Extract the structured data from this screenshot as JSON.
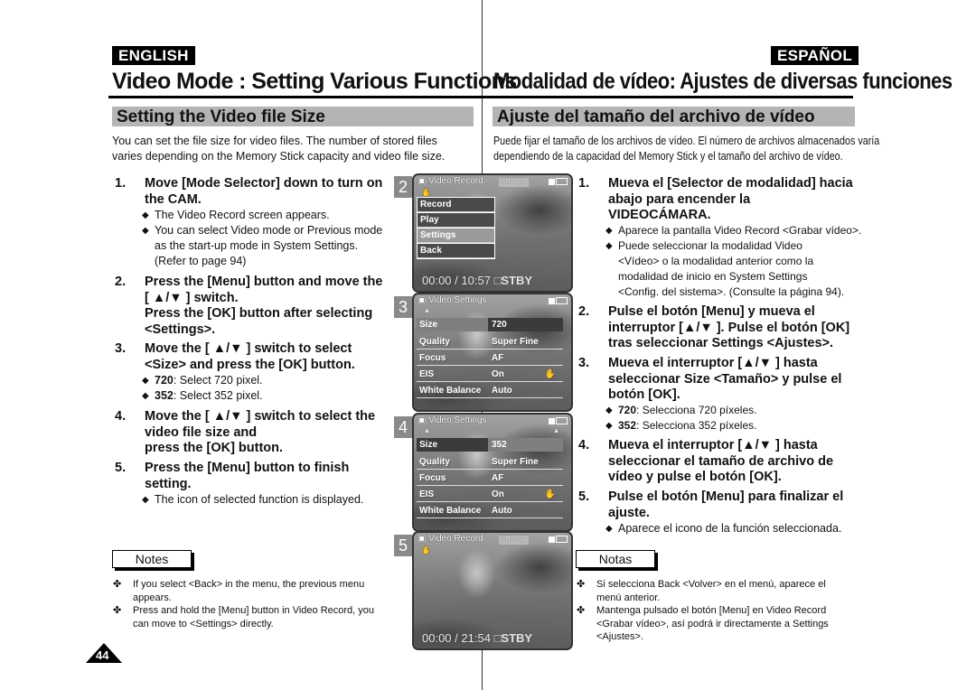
{
  "page_number": "44",
  "english": {
    "lang_label": "ENGLISH",
    "title": "Video Mode : Setting Various Functions",
    "section": "Setting the Video file Size",
    "intro": [
      "You can set the file size for video files. The number of stored files",
      "varies depending on the Memory Stick capacity and video file size."
    ],
    "steps": [
      {
        "num": "1.",
        "lines": [
          "Move [Mode Selector] down to turn on",
          "the CAM."
        ]
      },
      {
        "num": "2.",
        "lines": [
          "Press the [Menu] button and move the",
          "[ ▲/▼ ] switch.",
          "Press the [OK] button after selecting",
          "<Settings>."
        ]
      },
      {
        "num": "3.",
        "lines": [
          "Move the [ ▲/▼ ] switch to select",
          "<Size> and press the [OK] button."
        ]
      },
      {
        "num": "4.",
        "lines": [
          "Move the [ ▲/▼ ] switch to select the",
          "video file size and",
          "press the [OK] button."
        ]
      },
      {
        "num": "5.",
        "lines": [
          "Press the [Menu] button to finish",
          "setting."
        ]
      }
    ],
    "bullets": {
      "step1": [
        "The Video Record screen appears.",
        "You can select Video mode or Previous mode",
        "as the start-up mode in System Settings.",
        "(Refer to page 94)"
      ],
      "step3": [
        {
          "bold": "720",
          "text": ": Select 720 pixel."
        },
        {
          "bold": "352",
          "text": ": Select 352 pixel."
        }
      ],
      "step5": [
        "The icon of selected function is displayed."
      ]
    },
    "notes_label": "Notes",
    "notes": [
      [
        "If you select <Back> in the menu, the previous menu",
        "appears."
      ],
      [
        "Press and hold the [Menu] button in Video Record, you",
        "can move to <Settings> directly."
      ]
    ]
  },
  "spanish": {
    "lang_label": "ESPAÑOL",
    "title": "Modalidad de vídeo: Ajustes de diversas funciones",
    "section": "Ajuste del tamaño del archivo de vídeo",
    "intro": [
      "Puede fijar el tamaño de los archivos de vídeo. El número de archivos almacenados varía",
      "dependiendo de la capacidad del Memory Stick y el tamaño del archivo de vídeo."
    ],
    "steps": [
      {
        "num": "1.",
        "lines": [
          "Mueva el [Selector de modalidad] hacia",
          "abajo para encender la",
          "VIDEOCÁMARA."
        ]
      },
      {
        "num": "2.",
        "lines": [
          "Pulse el botón [Menu] y mueva el",
          "interruptor [▲/▼ ]. Pulse el botón [OK]",
          "tras seleccionar Settings <Ajustes>."
        ]
      },
      {
        "num": "3.",
        "lines": [
          "Mueva el interruptor [▲/▼ ] hasta",
          "seleccionar Size <Tamaño> y pulse el",
          "botón [OK]."
        ]
      },
      {
        "num": "4.",
        "lines": [
          "Mueva el interruptor [▲/▼ ] hasta",
          "seleccionar el tamaño de archivo de",
          "vídeo y pulse el botón [OK]."
        ]
      },
      {
        "num": "5.",
        "lines": [
          "Pulse el botón [Menu] para finalizar el",
          "ajuste."
        ]
      }
    ],
    "bullets": {
      "step1": [
        "Aparece la pantalla Video Record <Grabar vídeo>.",
        "Puede seleccionar la modalidad Video",
        "<Vídeo> o la modalidad anterior como la",
        "modalidad de inicio en System Settings",
        "<Config. del sistema>. (Consulte la página 94)."
      ],
      "step3": [
        {
          "bold": "720",
          "text": ": Selecciona 720 píxeles."
        },
        {
          "bold": "352",
          "text": ": Selecciona 352 píxeles."
        }
      ],
      "step5": [
        "Aparece el icono de la función seleccionada."
      ]
    },
    "notes_label": "Notas",
    "notes": [
      [
        "Si selecciona Back <Volver> en el menú, aparece el",
        "menú anterior."
      ],
      [
        "Mantenga pulsado el botón [Menu] en Video Record",
        "<Grabar vídeo>, así podrá ir directamente a Settings",
        "<Ajustes>."
      ]
    ]
  },
  "screens": [
    {
      "num": "2",
      "title": "Video Record",
      "quality": "SF",
      "size": "720",
      "menu": [
        "Record",
        "Play",
        "Settings",
        "Back"
      ],
      "menu_selected": "Settings",
      "counter": "00:00",
      "remaining": "10:57",
      "status": "STBY"
    },
    {
      "num": "3",
      "title": "Video Settings",
      "rows": [
        {
          "key": "Size",
          "value": "720"
        },
        {
          "key": "Quality",
          "value": "Super Fine"
        },
        {
          "key": "Focus",
          "value": "AF"
        },
        {
          "key": "EIS",
          "value": "On"
        },
        {
          "key": "White Balance",
          "value": "Auto"
        }
      ]
    },
    {
      "num": "4",
      "title": "Video Settings",
      "rows": [
        {
          "key": "Size",
          "value": "352"
        },
        {
          "key": "Quality",
          "value": "Super Fine"
        },
        {
          "key": "Focus",
          "value": "AF"
        },
        {
          "key": "EIS",
          "value": "On"
        },
        {
          "key": "White Balance",
          "value": "Auto"
        }
      ]
    },
    {
      "num": "5",
      "title": "Video Record",
      "quality": "SF",
      "size": "352",
      "counter": "00:00",
      "remaining": "21:54",
      "status": "STBY"
    }
  ],
  "symbols": {
    "bullet": "◆",
    "note_mark": "✤",
    "slash": "/"
  }
}
